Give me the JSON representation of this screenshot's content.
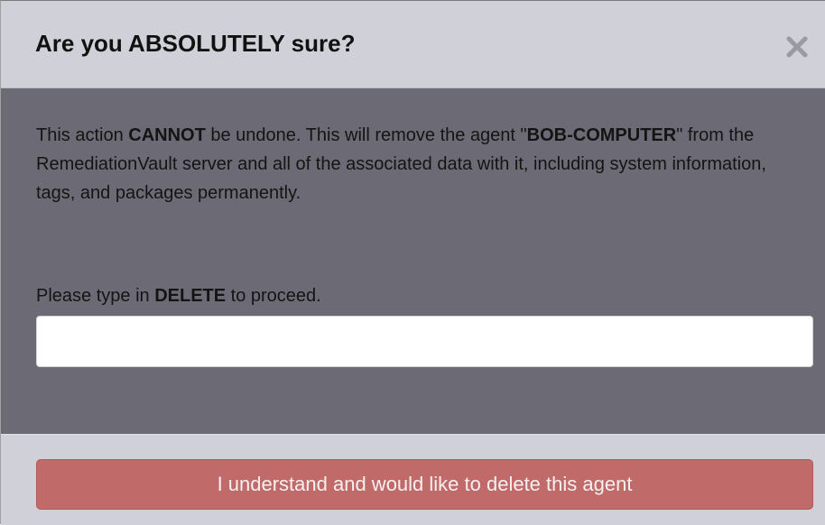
{
  "dialog": {
    "title": "Are you ABSOLUTELY sure?",
    "close_icon": "close-icon",
    "message": {
      "part1": "This action ",
      "strong1": "CANNOT",
      "part2": " be undone. This will remove the agent \"",
      "agent_name": "BOB-COMPUTER",
      "part3": "\" from the RemediationVault server and all of the associated data with it, including system information, tags, and packages permanently."
    },
    "prompt": {
      "part1": "Please type in ",
      "keyword": "DELETE",
      "part2": " to proceed."
    },
    "confirm_input": {
      "value": "",
      "placeholder": ""
    },
    "confirm_button_label": "I understand and would like to delete this agent"
  },
  "colors": {
    "header_bg": "#cfd0d8",
    "body_bg": "#6c6b75",
    "danger_button": "#c06a6a"
  }
}
